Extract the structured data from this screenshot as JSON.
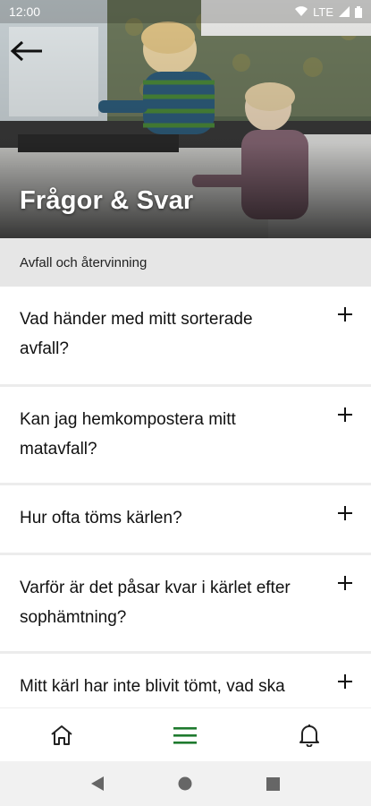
{
  "status_bar": {
    "time": "12:00",
    "network": "LTE"
  },
  "header": {
    "title": "Frågor & Svar"
  },
  "category": {
    "label": "Avfall och återvinning"
  },
  "faq": [
    {
      "question": "Vad händer med mitt sorterade avfall?"
    },
    {
      "question": "Kan jag hemkompostera mitt matavfall?"
    },
    {
      "question": "Hur ofta töms kärlen?"
    },
    {
      "question": "Varför är det påsar kvar i kärlet efter sophämtning?"
    },
    {
      "question": "Mitt kärl har inte blivit tömt, vad ska"
    }
  ],
  "bottom_nav": {
    "items": [
      {
        "icon": "home-icon",
        "active": false
      },
      {
        "icon": "menu-icon",
        "active": true
      },
      {
        "icon": "bell-icon",
        "active": false
      }
    ]
  },
  "colors": {
    "accent": "#1f7a2e",
    "category_bg": "#e6e6e6"
  }
}
